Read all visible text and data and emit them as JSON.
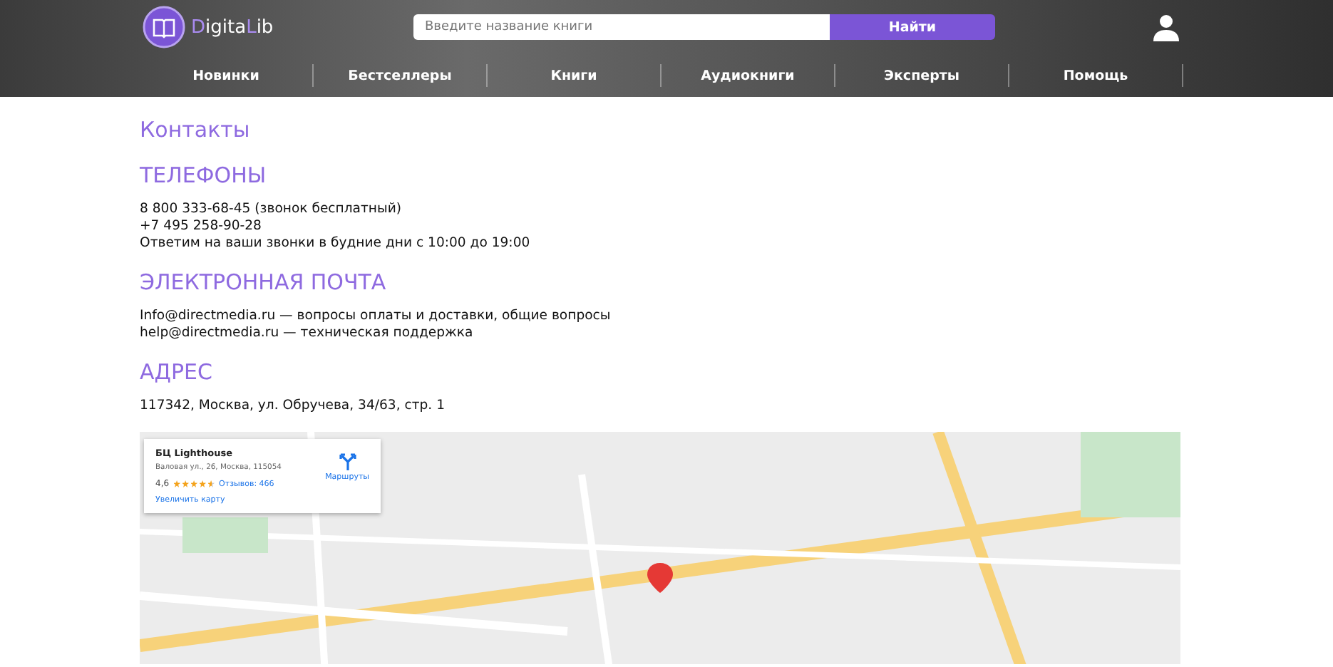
{
  "header": {
    "logo": [
      {
        "text": "D",
        "accent": true
      },
      {
        "text": "igita",
        "accent": false
      },
      {
        "text": "L",
        "accent": true
      },
      {
        "text": "ib",
        "accent": false
      }
    ],
    "search": {
      "placeholder": "Введите название книги",
      "button": "Найти"
    },
    "nav": [
      "Новинки",
      "Бестселлеры",
      "Книги",
      "Аудиокниги",
      "Эксперты",
      "Помощь"
    ]
  },
  "page_title": "Контакты",
  "sections": [
    {
      "heading": "ТЕЛЕФОНЫ",
      "lines": [
        "8 800 333-68-45 (звонок бесплатный)",
        "+7 495 258-90-28",
        "Ответим на ваши звонки в будние дни с 10:00 до 19:00"
      ]
    },
    {
      "heading": "ЭЛЕКТРОННАЯ ПОЧТА",
      "lines": [
        "Info@directmedia.ru — вопросы оплаты и доставки, общие вопросы",
        "help@directmedia.ru — техническая поддержка"
      ]
    },
    {
      "heading": "АДРЕС",
      "lines": [
        "117342, Москва, ул. Обручева, 34/63, стр. 1"
      ]
    }
  ],
  "map_card": {
    "name": "БЦ Lighthouse",
    "address": "Валовая ул., 26, Москва, 115054",
    "rating": "4,6",
    "stars": 4.5,
    "reviews": "Отзывов: 466",
    "directions": "Маршруты",
    "enlarge": "Увеличить карту"
  }
}
